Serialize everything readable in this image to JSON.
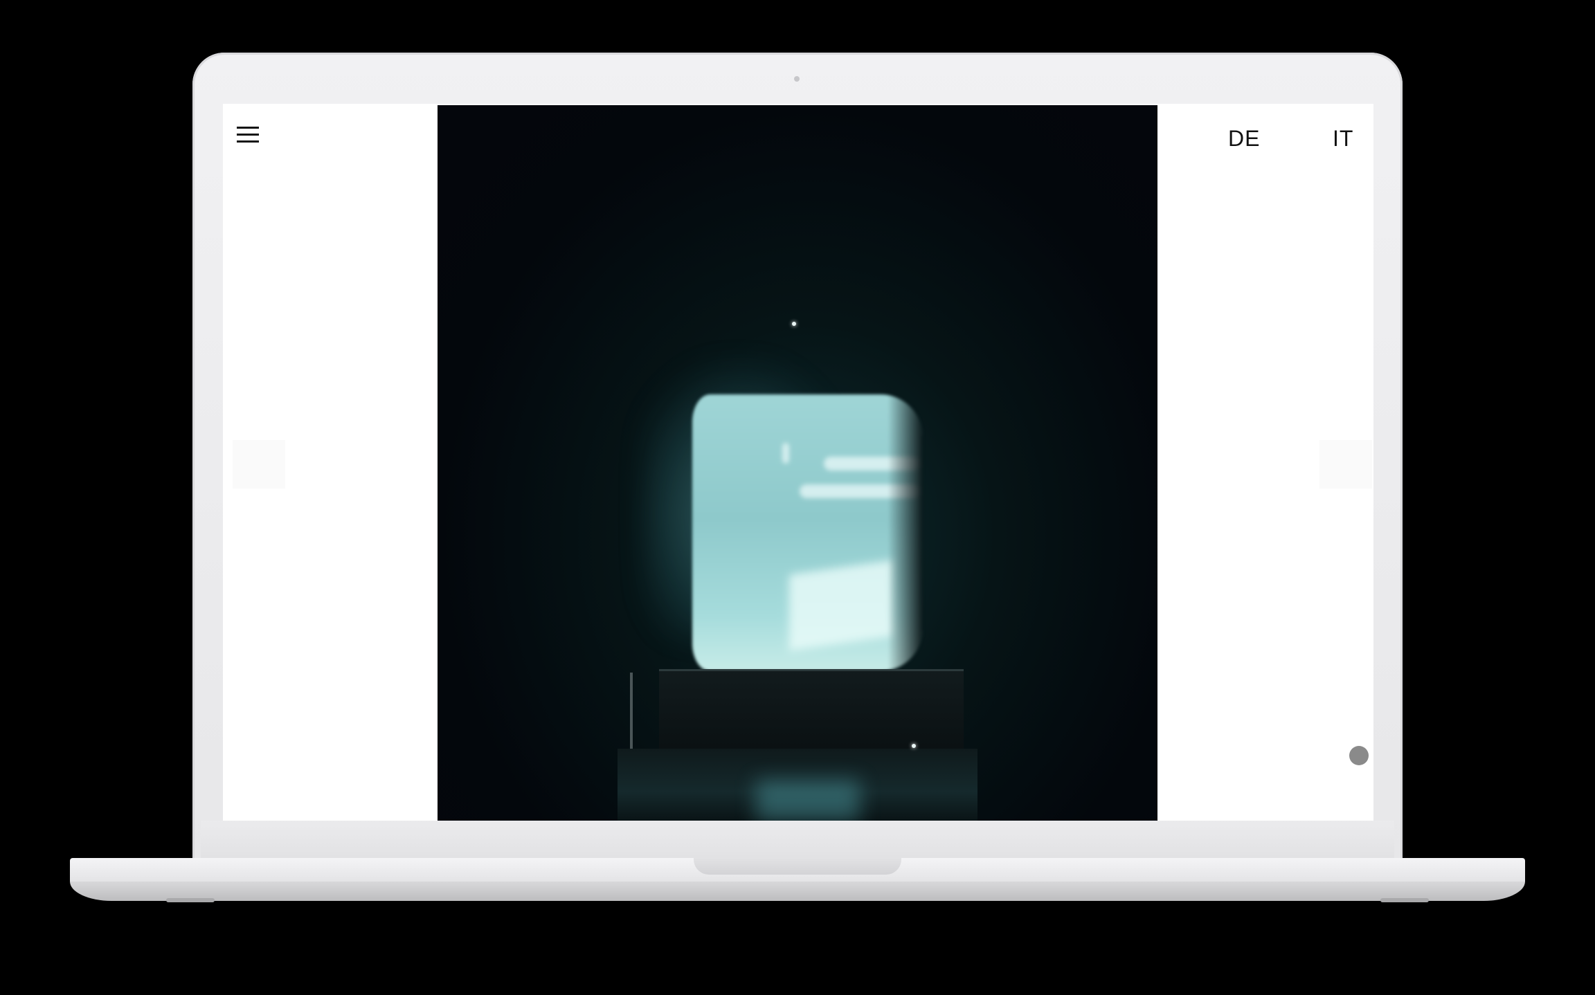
{
  "header": {
    "menu_icon": "hamburger-menu-icon",
    "languages": [
      "DE",
      "IT"
    ]
  },
  "media": {
    "description_icon": "video-still",
    "colors": {
      "screen_glow": "#9fd5d6",
      "background": "#04060c"
    }
  },
  "navigation": {
    "prev_icon": "arrow-left-icon",
    "next_icon": "arrow-right-icon"
  },
  "scroll_indicator": {
    "icon": "scroll-dot-icon",
    "color": "#8a8a8a"
  },
  "device": {
    "type": "laptop-mockup",
    "frame_color": "#e7e7e9"
  }
}
